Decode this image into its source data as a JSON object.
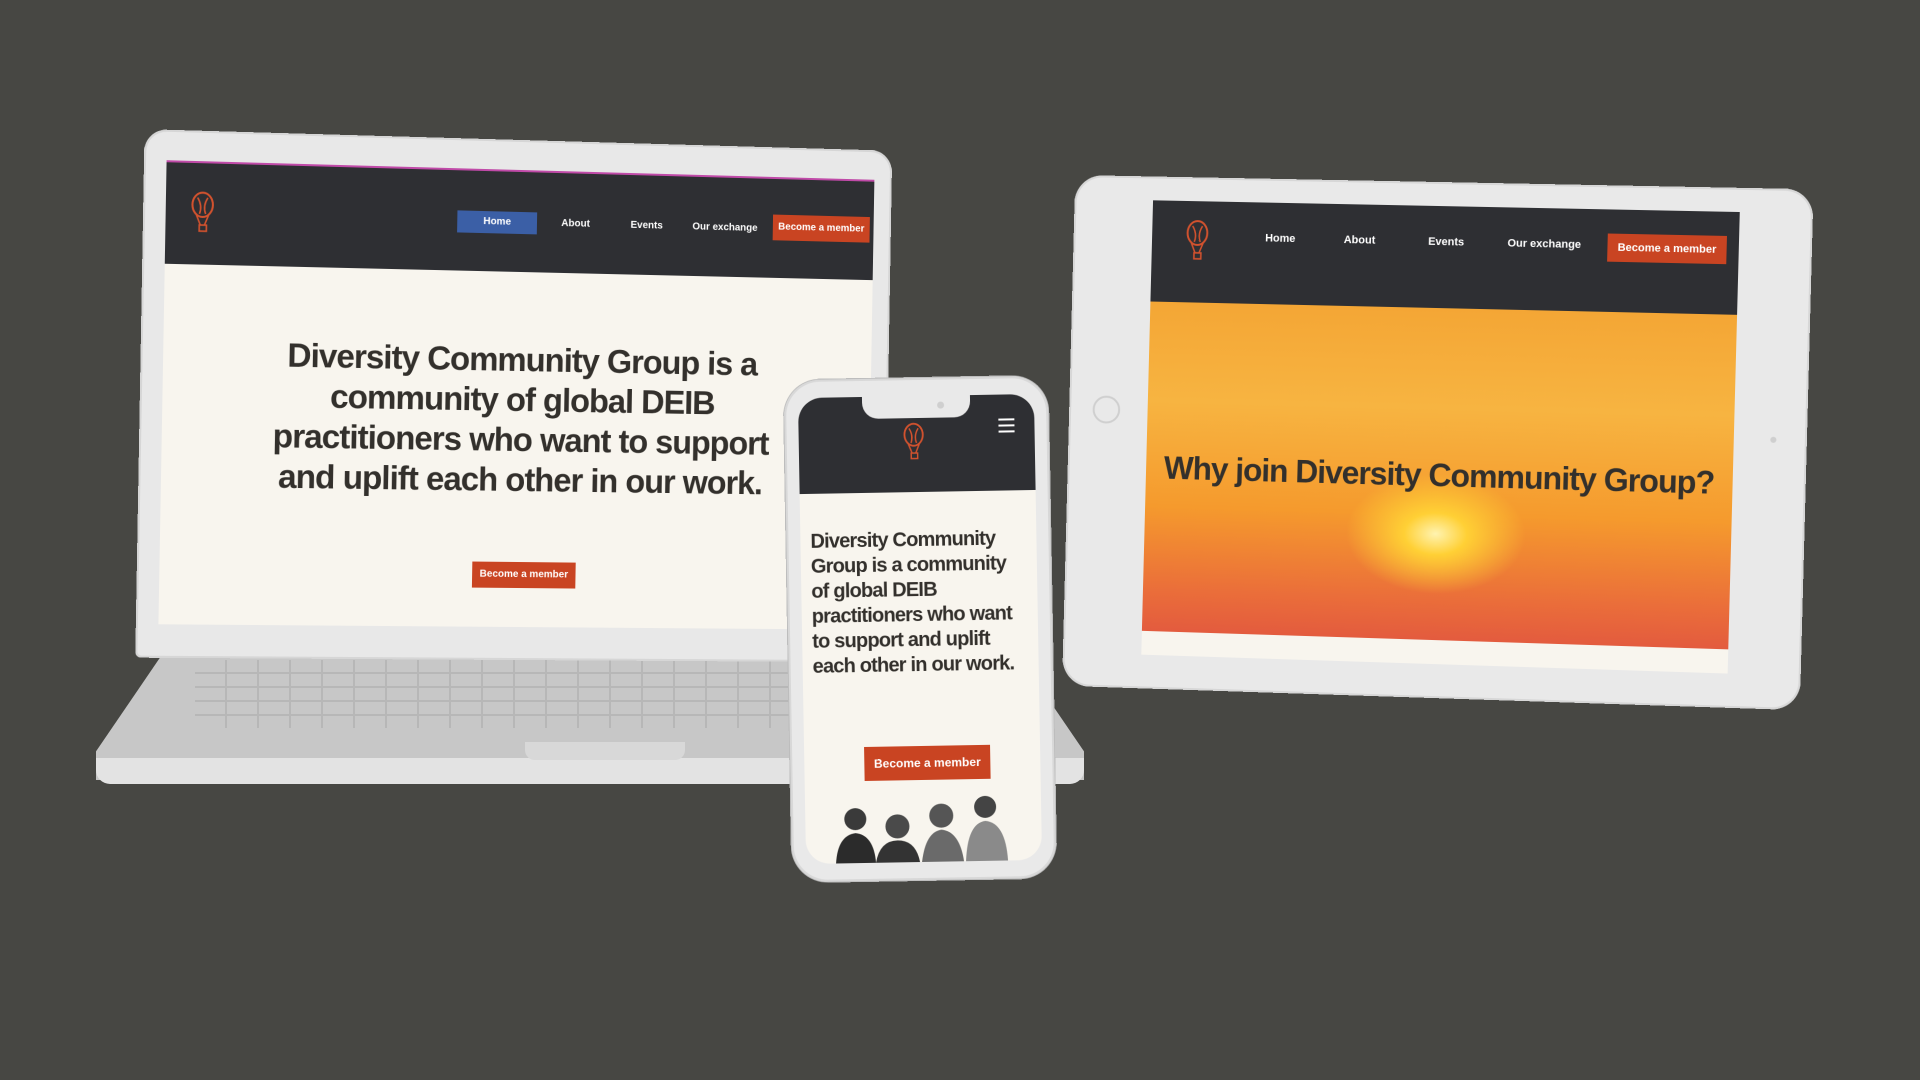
{
  "colors": {
    "background": "#474743",
    "nav": "#2e2f33",
    "accent": "#c94422",
    "active_nav": "#3b5fa6",
    "hero_bg": "#f8f5ee",
    "text": "#33302c"
  },
  "site": {
    "nav": {
      "home": "Home",
      "about": "About",
      "events": "Events",
      "exchange": "Our exchange",
      "cta": "Become a member"
    },
    "logo_icon": "hot-air-balloon-icon",
    "menu_icon": "hamburger-menu-icon"
  },
  "laptop": {
    "hero_title": "Diversity Community Group is a community of global DEIB practitioners who want to support and uplift each other in our work.",
    "hero_cta": "Become a member"
  },
  "tablet": {
    "hero_title": "Why join Diversity Community Group?"
  },
  "phone": {
    "hero_title": "Diversity Community Group is  a community of global DEIB practitioners who want to support and uplift each other in our work.",
    "hero_cta": "Become a member",
    "image_icon": "people-photo"
  }
}
